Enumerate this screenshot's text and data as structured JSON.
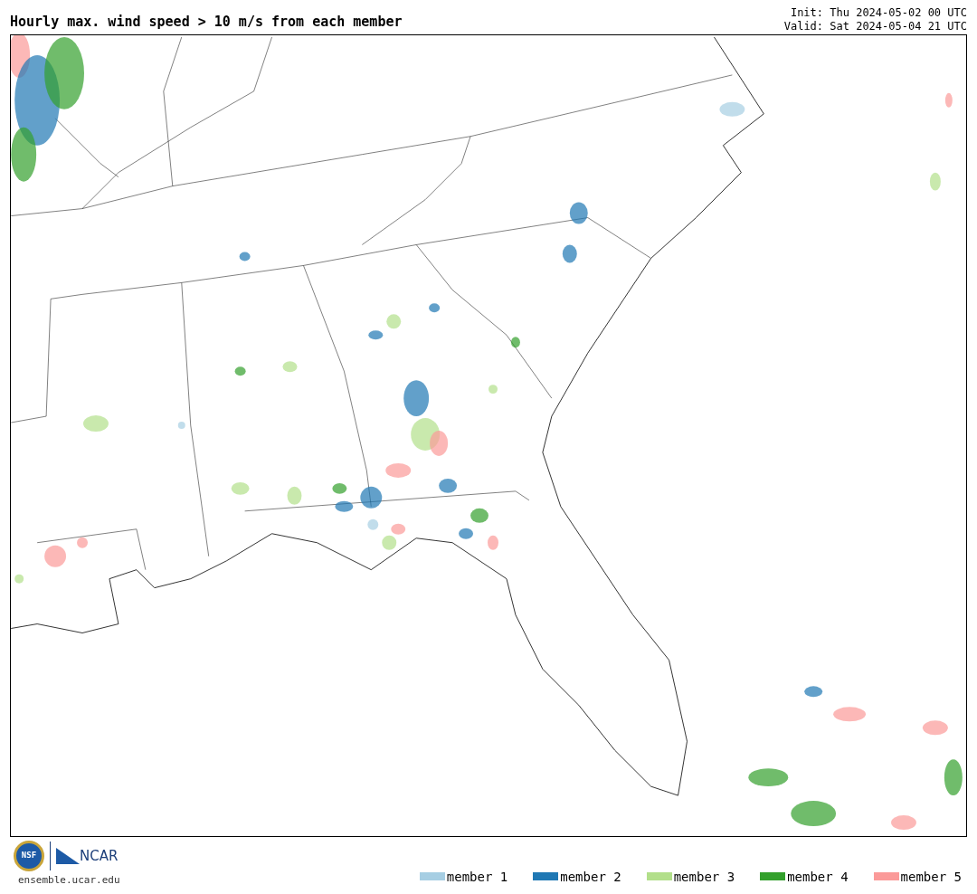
{
  "title": "Hourly max. wind speed > 10 m/s from each member",
  "init": "Init: Thu 2024-05-02 00 UTC",
  "valid": "Valid: Sat 2024-05-04 21 UTC",
  "logos": {
    "nsf": "NSF",
    "ncar": "NCAR",
    "site": "ensemble.ucar.edu"
  },
  "legend": [
    {
      "label": "member 1",
      "color": "#a6cee3"
    },
    {
      "label": "member 2",
      "color": "#1f78b4"
    },
    {
      "label": "member 3",
      "color": "#b2df8a"
    },
    {
      "label": "member 4",
      "color": "#33a02c"
    },
    {
      "label": "member 5",
      "color": "#fb9a99"
    }
  ]
}
